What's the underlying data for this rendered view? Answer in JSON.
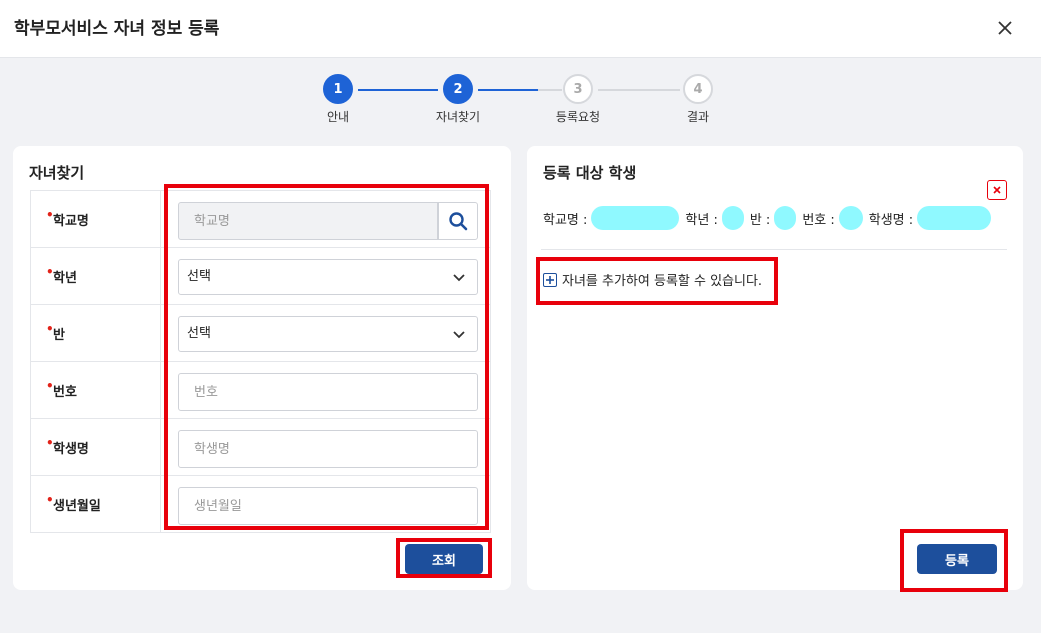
{
  "modal": {
    "title": "학부모서비스 자녀 정보 등록"
  },
  "stepper": {
    "steps": [
      {
        "number": "1",
        "label": "안내"
      },
      {
        "number": "2",
        "label": "자녀찾기"
      },
      {
        "number": "3",
        "label": "등록요청"
      },
      {
        "number": "4",
        "label": "결과"
      }
    ]
  },
  "search_panel": {
    "title": "자녀찾기",
    "fields": {
      "school": {
        "label": "학교명",
        "placeholder": "학교명"
      },
      "grade": {
        "label": "학년",
        "value": "선택"
      },
      "class": {
        "label": "반",
        "value": "선택"
      },
      "number": {
        "label": "번호",
        "placeholder": "번호"
      },
      "name": {
        "label": "학생명",
        "placeholder": "학생명"
      },
      "birth": {
        "label": "생년월일",
        "placeholder": "생년월일"
      }
    },
    "search_button": "조회"
  },
  "register_panel": {
    "title": "등록 대상 학생",
    "info": {
      "school_label": "학교명 :",
      "grade_label": "학년 :",
      "class_label": "반 :",
      "number_label": "번호 :",
      "name_label": "학생명 :"
    },
    "add_hint": "자녀를 추가하여 등록할 수 있습니다.",
    "register_button": "등록"
  },
  "colors": {
    "primary": "#1e63d6",
    "button": "#1d4f9c",
    "highlight": "#e8000b",
    "redacted": "#8ff9ff"
  }
}
